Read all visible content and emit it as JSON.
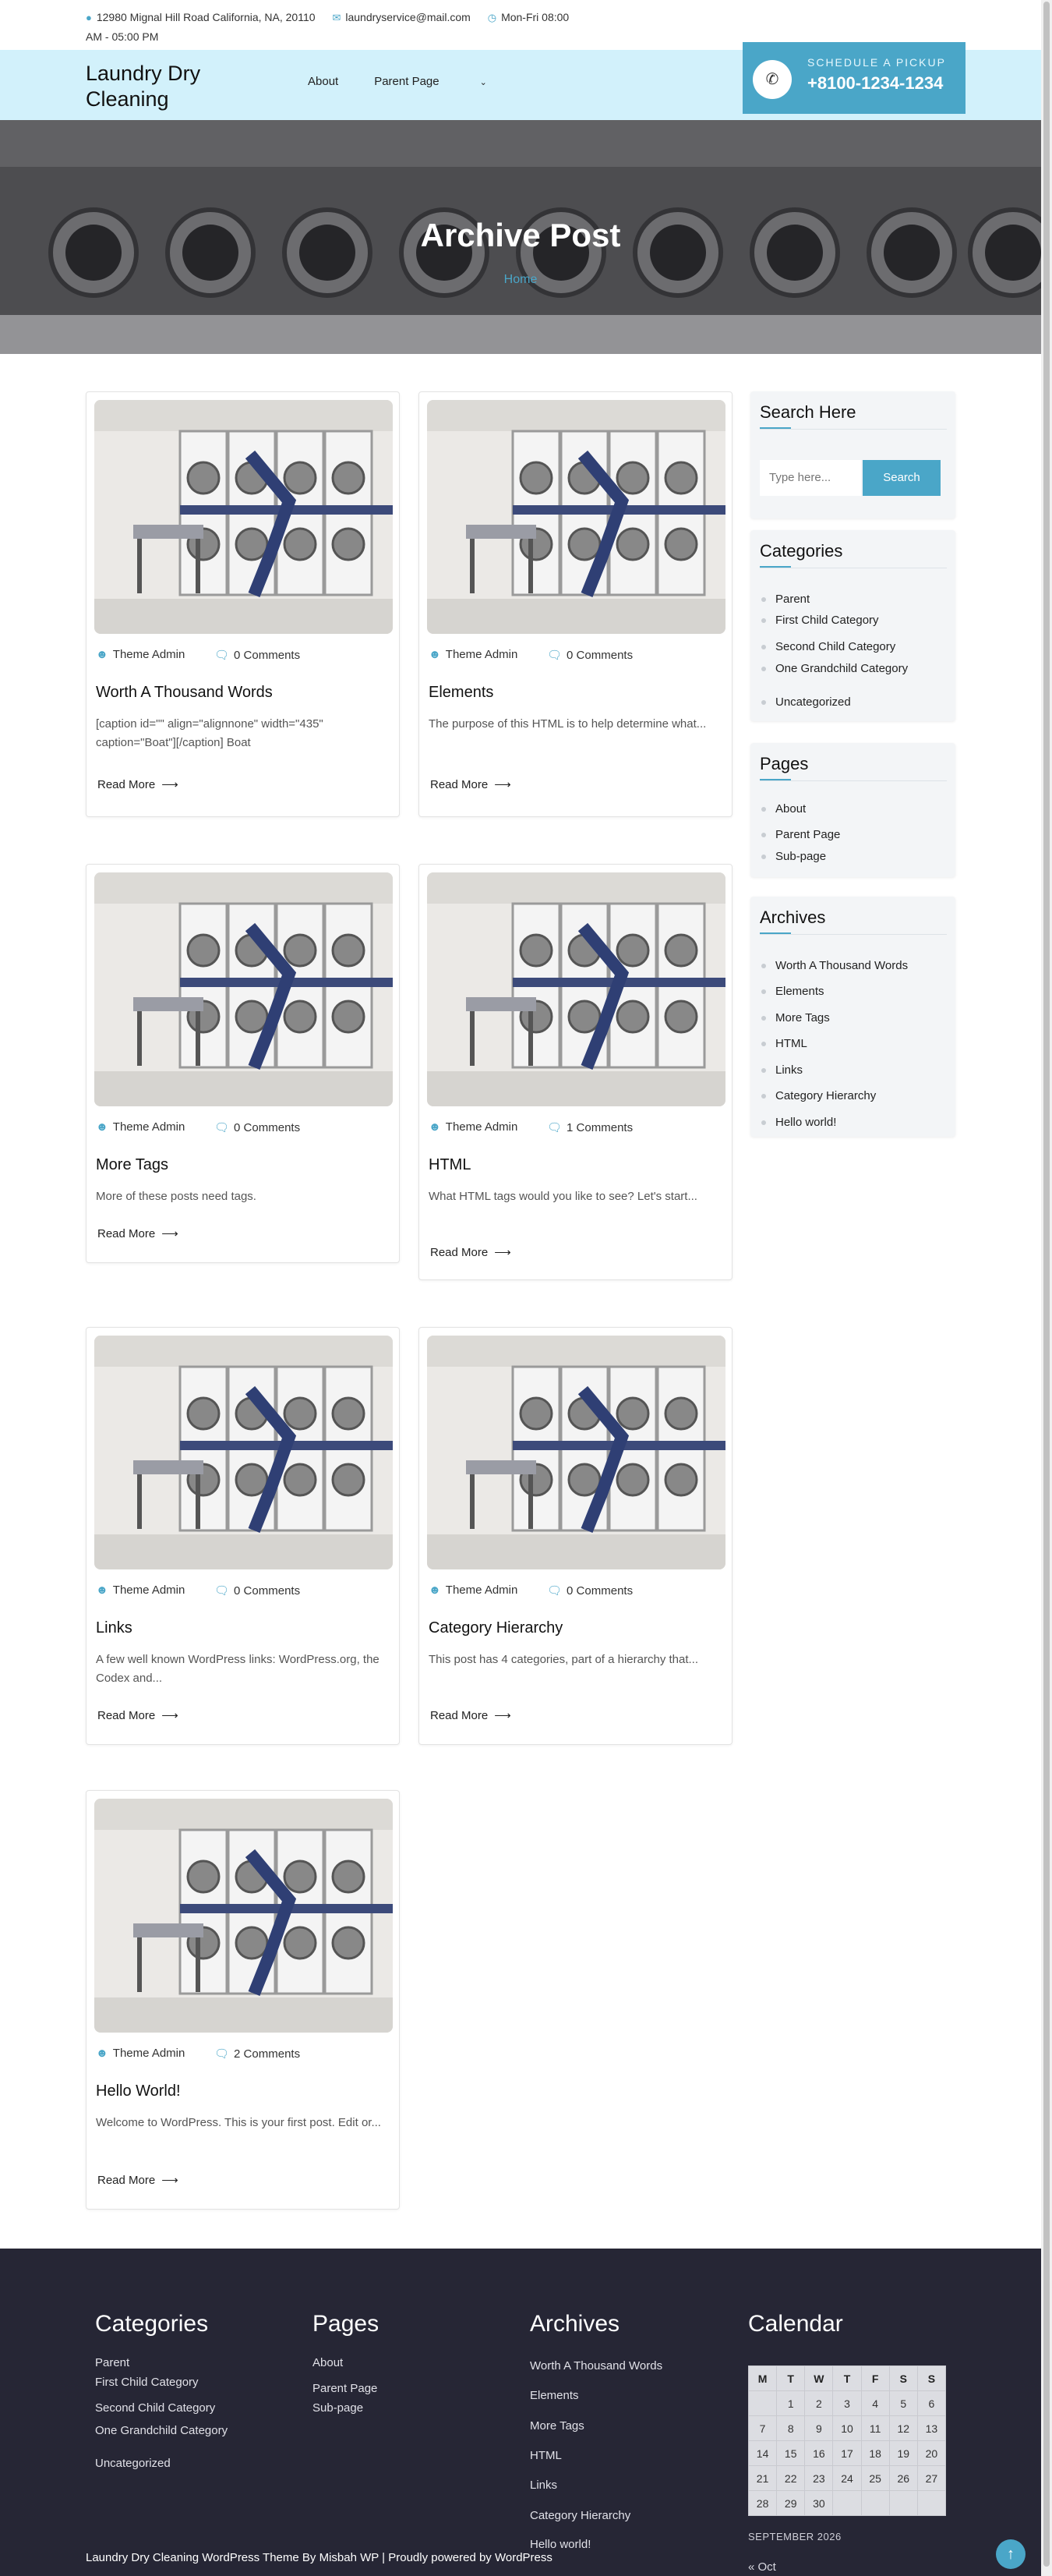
{
  "topbar": {
    "address": "12980 Mignal Hill Road California, NA, 20110",
    "email": "laundryservice@mail.com",
    "hours": "Mon-Fri 08:00 AM - 05:00 PM"
  },
  "header": {
    "logo": "Laundry Dry Cleaning",
    "nav": [
      "About",
      "Parent Page"
    ],
    "pickup_label": "SCHEDULE A PICKUP",
    "pickup_phone": "+8100-1234-1234"
  },
  "hero": {
    "title": "Archive Post",
    "breadcrumb": "Home"
  },
  "posts": [
    {
      "title": "Worth A Thousand Words",
      "author": "Theme Admin",
      "comments": "0 Comments",
      "excerpt": "[caption id=\"\" align=\"alignnone\" width=\"435\" caption=\"Boat\"][/caption] Boat",
      "read_more": "Read More"
    },
    {
      "title": "Elements",
      "author": "Theme Admin",
      "comments": "0 Comments",
      "excerpt": "The purpose of this HTML is to help determine what...",
      "read_more": "Read More"
    },
    {
      "title": "More Tags",
      "author": "Theme Admin",
      "comments": "0 Comments",
      "excerpt": "More of these posts need tags.",
      "read_more": "Read More"
    },
    {
      "title": "HTML",
      "author": "Theme Admin",
      "comments": "1 Comments",
      "excerpt": "What HTML tags would you like to see? Let's start...",
      "read_more": "Read More"
    },
    {
      "title": "Links",
      "author": "Theme Admin",
      "comments": "0 Comments",
      "excerpt": "A few well known WordPress links: WordPress.org, the Codex and...",
      "read_more": "Read More"
    },
    {
      "title": "Category Hierarchy",
      "author": "Theme Admin",
      "comments": "0 Comments",
      "excerpt": "This post has 4 categories, part of a hierarchy that...",
      "read_more": "Read More"
    },
    {
      "title": "Hello World!",
      "author": "Theme Admin",
      "comments": "2 Comments",
      "excerpt": "Welcome to WordPress. This is your first post. Edit or...",
      "read_more": "Read More"
    }
  ],
  "sidebar": {
    "search": {
      "title": "Search Here",
      "placeholder": "Type here...",
      "button": "Search"
    },
    "categories": {
      "title": "Categories",
      "items": [
        "Parent",
        "First Child Category",
        "Second Child Category",
        "One Grandchild Category",
        "Uncategorized"
      ]
    },
    "pages": {
      "title": "Pages",
      "items": [
        "About",
        "Parent Page",
        "Sub-page"
      ]
    },
    "archives": {
      "title": "Archives",
      "items": [
        "Worth A Thousand Words",
        "Elements",
        "More Tags",
        "HTML",
        "Links",
        "Category Hierarchy",
        "Hello world!"
      ]
    }
  },
  "footer": {
    "categories": {
      "title": "Categories",
      "items": [
        "Parent",
        "First Child Category",
        "Second Child Category",
        "One Grandchild Category",
        "Uncategorized"
      ]
    },
    "pages": {
      "title": "Pages",
      "items": [
        "About",
        "Parent Page",
        "Sub-page"
      ]
    },
    "archives": {
      "title": "Archives",
      "items": [
        "Worth A Thousand Words",
        "Elements",
        "More Tags",
        "HTML",
        "Links",
        "Category Hierarchy",
        "Hello world!"
      ]
    },
    "calendar": {
      "title": "Calendar",
      "days": [
        "M",
        "T",
        "W",
        "T",
        "F",
        "S",
        "S"
      ],
      "weeks": [
        [
          "",
          "1",
          "2",
          "3",
          "4",
          "5",
          "6"
        ],
        [
          "7",
          "8",
          "9",
          "10",
          "11",
          "12",
          "13"
        ],
        [
          "14",
          "15",
          "16",
          "17",
          "18",
          "19",
          "20"
        ],
        [
          "21",
          "22",
          "23",
          "24",
          "25",
          "26",
          "27"
        ],
        [
          "28",
          "29",
          "30",
          "",
          "",
          "",
          ""
        ]
      ],
      "caption": "SEPTEMBER 2026",
      "prev": "« Oct"
    },
    "copyright": "Laundry Dry Cleaning WordPress Theme By Misbah WP | Proudly powered by WordPress"
  },
  "colors": {
    "accent": "#4aa6c8",
    "header_bg": "#d2f1fb",
    "footer_bg": "#262635"
  }
}
